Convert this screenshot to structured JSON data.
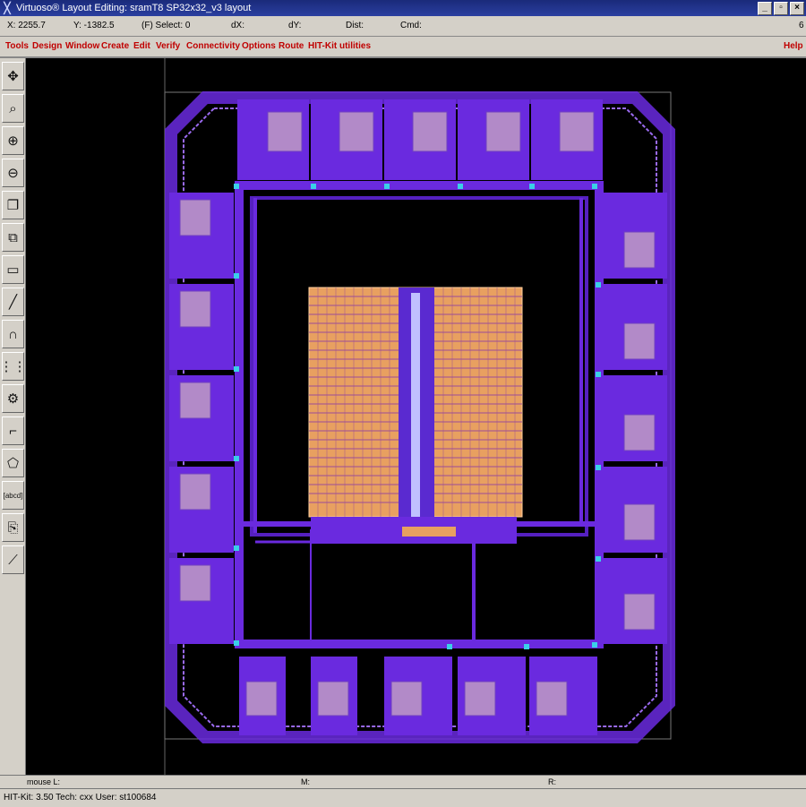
{
  "window": {
    "title": "Virtuoso® Layout Editing: sramT8 SP32x32_v3 layout",
    "buttons": [
      "_",
      "▫",
      "×"
    ]
  },
  "coords": {
    "x": "X:  2255.7",
    "y": "Y:  -1382.5",
    "select": "(F) Select: 0",
    "dx": "dX:",
    "dy": "dY:",
    "dist": "Dist:",
    "cmd": "Cmd:",
    "right_num": "6"
  },
  "menu": [
    {
      "label": "Tools"
    },
    {
      "label": "Design"
    },
    {
      "label": "Window"
    },
    {
      "label": "Create"
    },
    {
      "label": "Edit"
    },
    {
      "label": "Verify"
    },
    {
      "label": "Connectivity"
    },
    {
      "label": "Options"
    },
    {
      "label": "Route"
    },
    {
      "label": "HIT-Kit utilities"
    }
  ],
  "help_label": "Help",
  "tools": [
    {
      "icon": "move-cursor-icon",
      "glyph": "✥"
    },
    {
      "icon": "zoom-fit-icon",
      "glyph": "⌕"
    },
    {
      "icon": "zoom-in-icon",
      "glyph": "⊕"
    },
    {
      "icon": "zoom-out-icon",
      "glyph": "⊖"
    },
    {
      "icon": "copy-icon",
      "glyph": "❐"
    },
    {
      "icon": "stretch-icon",
      "glyph": "⧉"
    },
    {
      "icon": "rectangle-icon",
      "glyph": "▭"
    },
    {
      "icon": "path-icon",
      "glyph": "╱"
    },
    {
      "icon": "arc-icon",
      "glyph": "∩"
    },
    {
      "icon": "ruler-icon",
      "glyph": "⋮⋮"
    },
    {
      "icon": "instance-icon",
      "glyph": "⚙"
    },
    {
      "icon": "wire-icon",
      "glyph": "⌐"
    },
    {
      "icon": "polygon-icon",
      "glyph": "⬠"
    },
    {
      "icon": "label-icon",
      "glyph": "[abcd]"
    },
    {
      "icon": "property-icon",
      "glyph": "⎘"
    },
    {
      "icon": "line-icon",
      "glyph": "⟋"
    }
  ],
  "status": {
    "mouse": "mouse L:",
    "m": "M:",
    "r": "R:",
    "kit": "HIT-Kit: 3.50   Tech: cxx   User: st100684"
  },
  "colors": {
    "layout_purple": "#6a2adf",
    "layout_magenta": "#b05ad8",
    "pad_fill": "#b28ac8",
    "array_orange": "#e8a060",
    "background": "#000000"
  }
}
